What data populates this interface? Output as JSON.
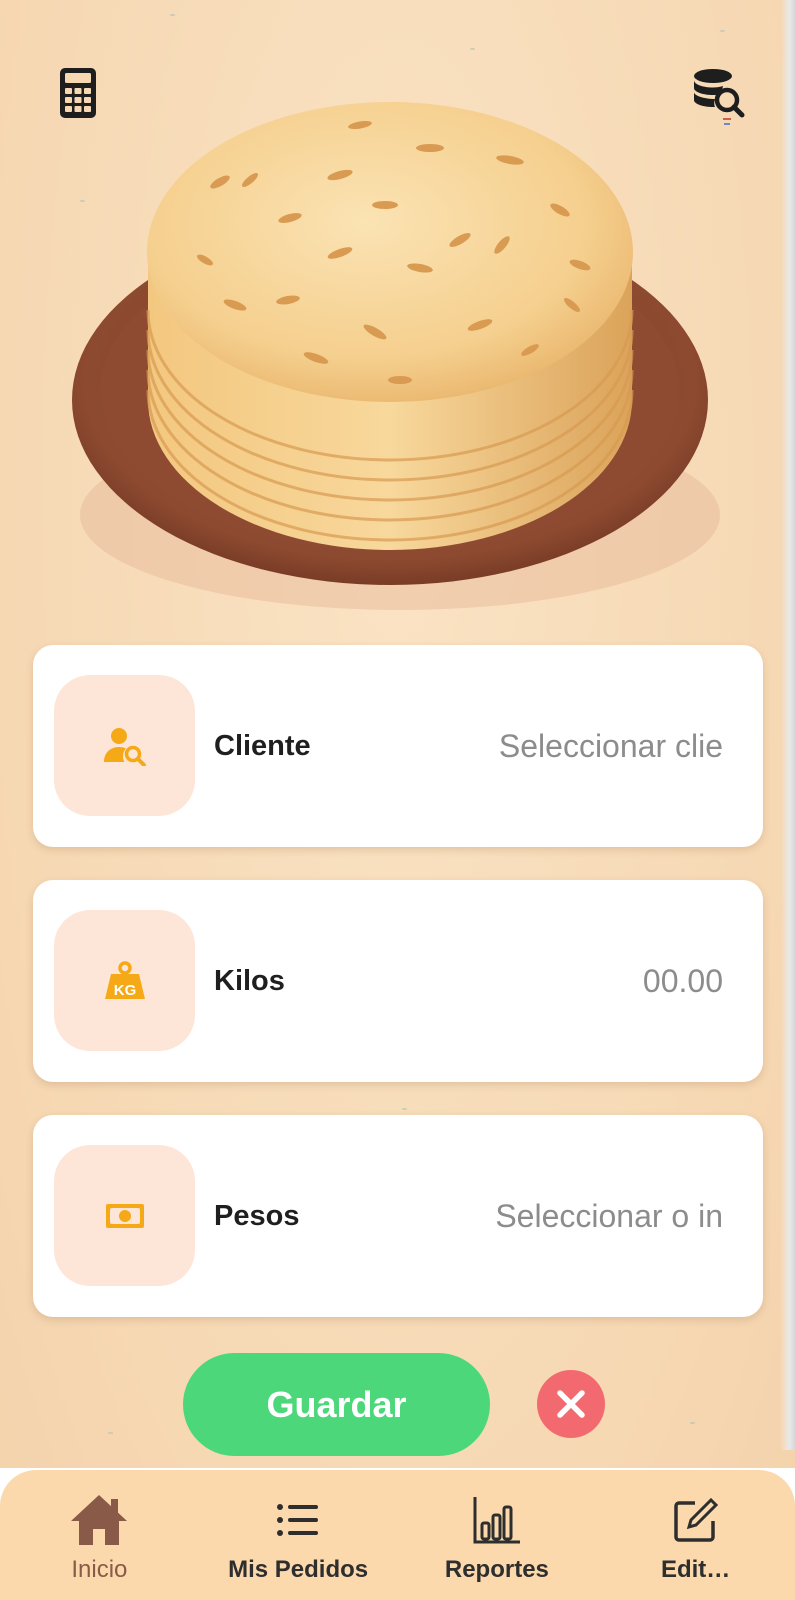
{
  "colors": {
    "background": "#f7dcb8",
    "card": "#ffffff",
    "icon_box": "#fde6d8",
    "icon_accent": "#f6a916",
    "save_button": "#4cd87a",
    "cancel_button": "#f26a6f",
    "nav_bar": "#fbd9ad",
    "nav_active": "#8a5a49"
  },
  "header": {
    "left_icon": "calculator-icon",
    "right_icon": "database-search-icon"
  },
  "hero": {
    "image": "tortilla-stack-on-plate-illustration"
  },
  "form": {
    "fields": [
      {
        "icon": "user-search-icon",
        "label": "Cliente",
        "value": "Seleccionar clie"
      },
      {
        "icon": "kg-weight-icon",
        "label": "Kilos",
        "value": "00.00"
      },
      {
        "icon": "cash-icon",
        "label": "Pesos",
        "value": "Seleccionar o in"
      }
    ]
  },
  "actions": {
    "save_label": "Guardar",
    "cancel_icon": "close-icon"
  },
  "nav": {
    "items": [
      {
        "icon": "home-icon",
        "label": "Inicio",
        "active": true
      },
      {
        "icon": "list-icon",
        "label": "Mis Pedidos",
        "active": false
      },
      {
        "icon": "bar-chart-icon",
        "label": "Reportes",
        "active": false
      },
      {
        "icon": "edit-icon",
        "label": "Edit…",
        "active": false
      }
    ]
  }
}
